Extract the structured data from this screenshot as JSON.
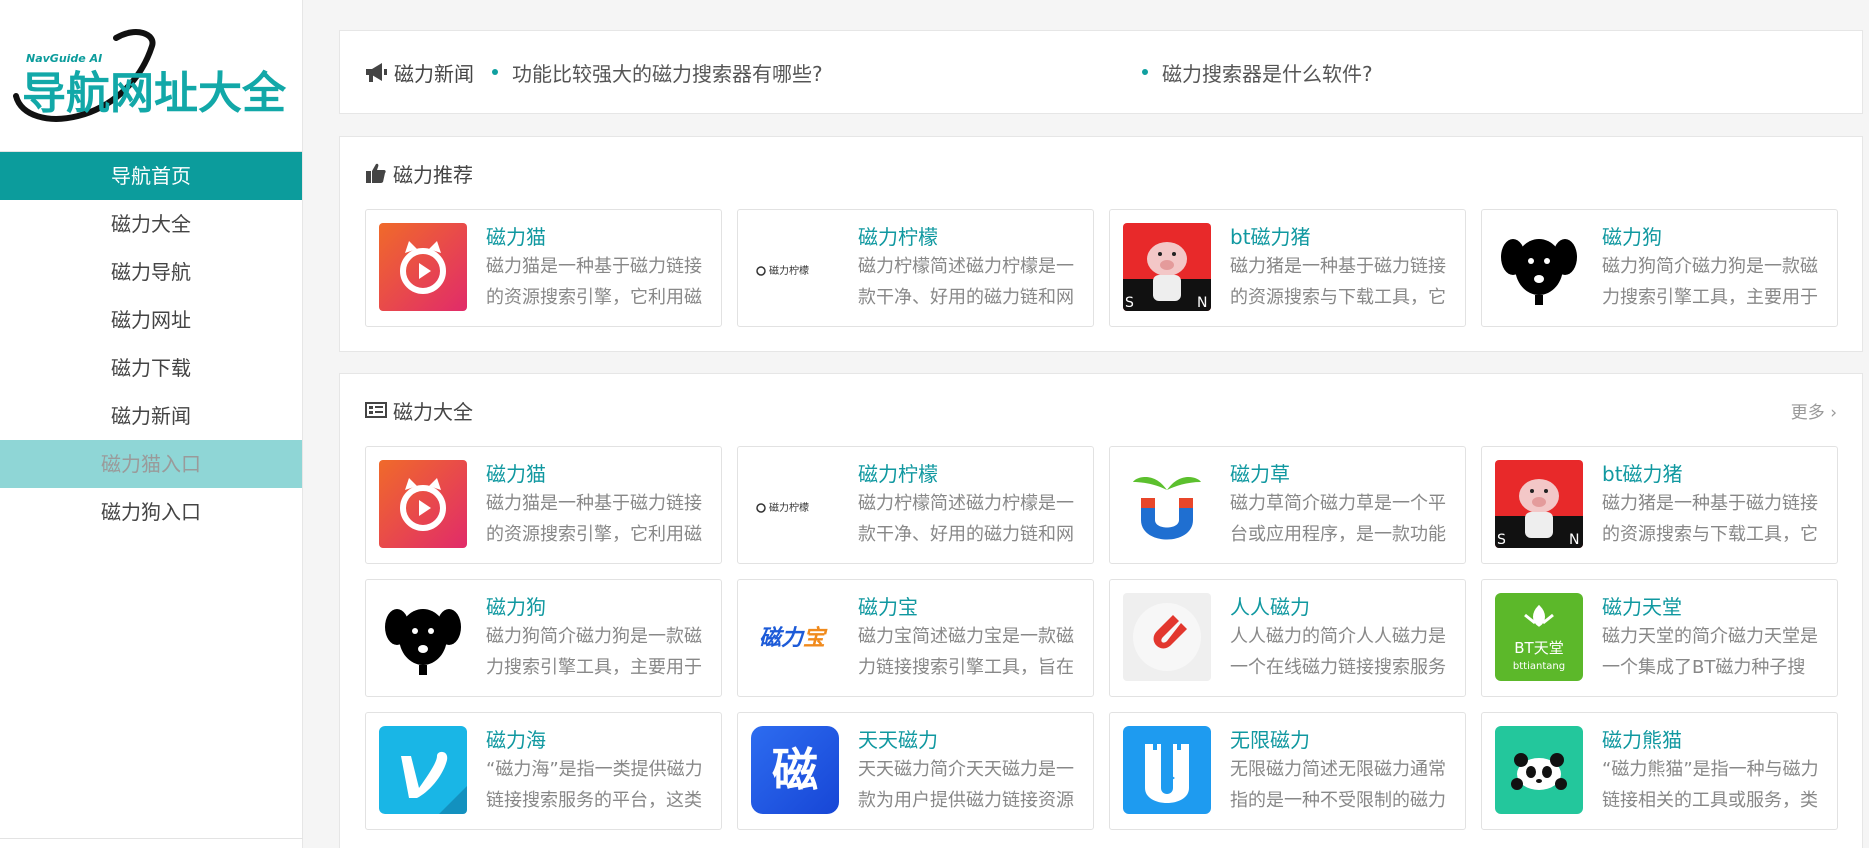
{
  "logo": {
    "small_text": "NavGuide AI",
    "main_text": "导航网址大全"
  },
  "sidebar": {
    "items": [
      {
        "label": "导航首页",
        "state": "active"
      },
      {
        "label": "磁力大全",
        "state": ""
      },
      {
        "label": "磁力导航",
        "state": ""
      },
      {
        "label": "磁力网址",
        "state": ""
      },
      {
        "label": "磁力下载",
        "state": ""
      },
      {
        "label": "磁力新闻",
        "state": ""
      },
      {
        "label": "磁力猫入口",
        "state": "hover"
      },
      {
        "label": "磁力狗入口",
        "state": ""
      }
    ]
  },
  "news": {
    "title": "磁力新闻",
    "items": [
      "功能比较强大的磁力搜索器有哪些?",
      "磁力搜索器是什么软件?"
    ]
  },
  "recommend": {
    "title": "磁力推荐",
    "cards": [
      {
        "title": "磁力猫",
        "desc": "磁力猫是一种基于磁力链接的资源搜索引擎，它利用磁",
        "icon": "cat-play-icon"
      },
      {
        "title": "磁力柠檬",
        "desc": "磁力柠檬简述磁力柠檬是一款干净、好用的磁力链和网",
        "icon": "lemon-logo-icon"
      },
      {
        "title": "bt磁力猪",
        "desc": "磁力猪是一种基于磁力链接的资源搜索与下载工具，它",
        "icon": "pig-icon"
      },
      {
        "title": "磁力狗",
        "desc": "磁力狗简介磁力狗是一款磁力搜索引擎工具，主要用于",
        "icon": "dog-icon"
      }
    ]
  },
  "all": {
    "title": "磁力大全",
    "more": "更多 ›",
    "cards": [
      {
        "title": "磁力猫",
        "desc": "磁力猫是一种基于磁力链接的资源搜索引擎，它利用磁",
        "icon": "cat-play-icon"
      },
      {
        "title": "磁力柠檬",
        "desc": "磁力柠檬简述磁力柠檬是一款干净、好用的磁力链和网",
        "icon": "lemon-logo-icon"
      },
      {
        "title": "磁力草",
        "desc": "磁力草简介磁力草是一个平台或应用程序，是一款功能",
        "icon": "magnet-sprout-icon"
      },
      {
        "title": "bt磁力猪",
        "desc": "磁力猪是一种基于磁力链接的资源搜索与下载工具，它",
        "icon": "pig-icon"
      },
      {
        "title": "磁力狗",
        "desc": "磁力狗简介磁力狗是一款磁力搜索引擎工具，主要用于",
        "icon": "dog-icon"
      },
      {
        "title": "磁力宝",
        "desc": "磁力宝简述磁力宝是一款磁力链接搜索引擎工具，旨在",
        "icon": "cilibao-logo-icon"
      },
      {
        "title": "人人磁力",
        "desc": "人人磁力的简介人人磁力是一个在线磁力链接搜索服务",
        "icon": "red-magnet-icon"
      },
      {
        "title": "磁力天堂",
        "desc": "磁力天堂的简介磁力天堂是一个集成了BT磁力种子搜",
        "icon": "bt-tiantang-icon"
      },
      {
        "title": "磁力海",
        "desc": "“磁力海”是指一类提供磁力链接搜索服务的平台，这类平",
        "icon": "v-logo-icon"
      },
      {
        "title": "天天磁力",
        "desc": "天天磁力简介天天磁力是一款为用户提供磁力链接资源",
        "icon": "ci-char-icon"
      },
      {
        "title": "无限磁力",
        "desc": "无限磁力简述无限磁力通常指的是一种不受限制的磁力",
        "icon": "castle-play-icon"
      },
      {
        "title": "磁力熊猫",
        "desc": "“磁力熊猫”是指一种与磁力链接相关的工具或服务，类似",
        "icon": "panda-icon"
      }
    ]
  },
  "icon_text": {
    "lemon": "磁力柠檬",
    "cilibao": "磁力宝",
    "bt_tiantang_1": "BT天堂",
    "bt_tiantang_2": "bttiantang",
    "ci": "磁",
    "pig_letters": "S N"
  },
  "colors": {
    "accent": "#0c9c9c",
    "link": "#1098a0",
    "hover_bg": "#8fd6d6"
  }
}
